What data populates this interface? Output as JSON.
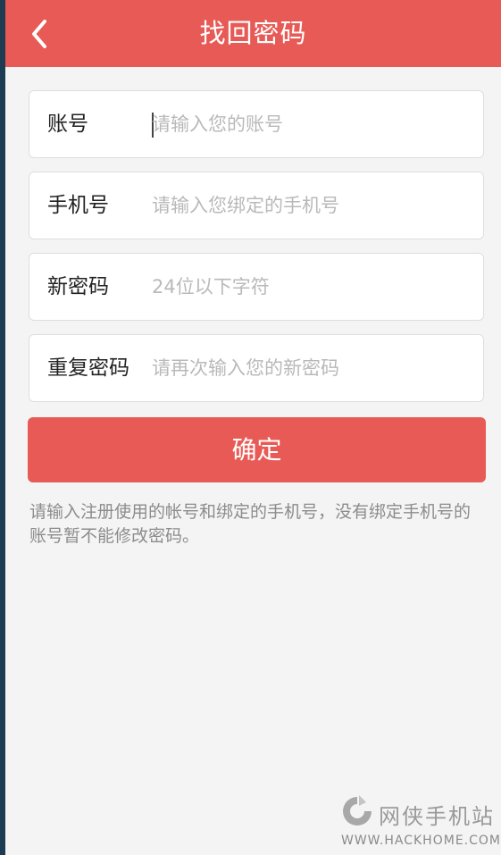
{
  "header": {
    "title": "找回密码",
    "back_icon": "chevron-left-icon"
  },
  "form": {
    "fields": [
      {
        "label": "账号",
        "value": "",
        "placeholder": "请输入您的账号"
      },
      {
        "label": "手机号",
        "value": "",
        "placeholder": "请输入您绑定的手机号"
      },
      {
        "label": "新密码",
        "value": "",
        "placeholder": "24位以下字符"
      },
      {
        "label": "重复密码",
        "value": "",
        "placeholder": "请再次输入您的新密码"
      }
    ],
    "submit_label": "确定"
  },
  "hint": "请输入注册使用的帐号和绑定的手机号，没有绑定手机号的账号暂不能修改密码。",
  "watermark": {
    "name": "网侠手机站",
    "url": "WWW.HACKHOME.COM"
  },
  "colors": {
    "accent": "#e85a55",
    "background": "#f4f4f4",
    "placeholder": "#b9b9b9",
    "hint_text": "#8c8c8c"
  }
}
